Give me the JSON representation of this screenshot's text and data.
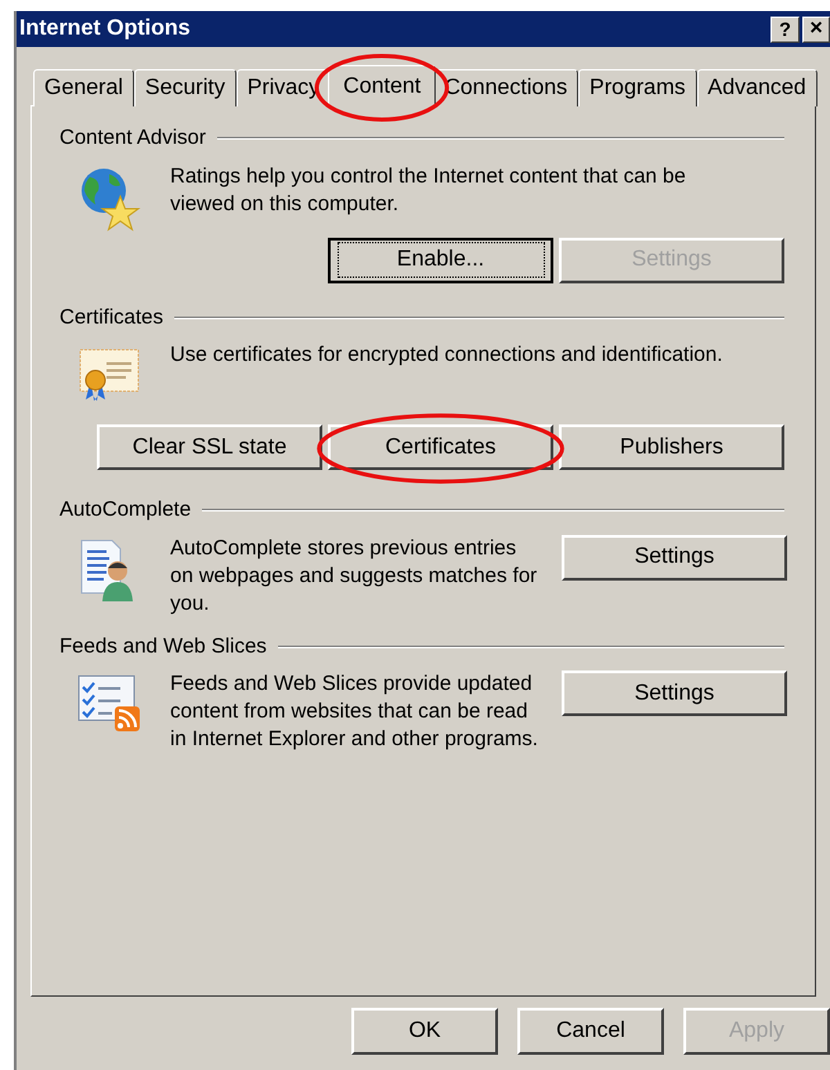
{
  "window": {
    "title": "Internet Options",
    "help_button": "?",
    "close_button": "×"
  },
  "tabs": [
    {
      "label": "General",
      "selected": false,
      "circled": false
    },
    {
      "label": "Security",
      "selected": false,
      "circled": false
    },
    {
      "label": "Privacy",
      "selected": false,
      "circled": false
    },
    {
      "label": "Content",
      "selected": true,
      "circled": true
    },
    {
      "label": "Connections",
      "selected": false,
      "circled": false
    },
    {
      "label": "Programs",
      "selected": false,
      "circled": false
    },
    {
      "label": "Advanced",
      "selected": false,
      "circled": false
    }
  ],
  "sections": [
    {
      "title": "Content Advisor",
      "kind": "stacked",
      "description": "Ratings help you control the Internet content that can be viewed on this computer.",
      "buttons": [
        {
          "label": "Enable...",
          "disabled": false,
          "default": true,
          "circled": false
        },
        {
          "label": "Settings",
          "disabled": true,
          "default": false,
          "circled": false
        }
      ]
    },
    {
      "title": "Certificates",
      "kind": "stacked",
      "description": "Use certificates for encrypted connections and identification.",
      "buttons": [
        {
          "label": "Clear SSL state",
          "disabled": false,
          "default": false,
          "circled": false
        },
        {
          "label": "Certificates",
          "disabled": false,
          "default": false,
          "circled": true
        },
        {
          "label": "Publishers",
          "disabled": false,
          "default": false,
          "circled": false
        }
      ]
    },
    {
      "title": "AutoComplete",
      "kind": "inline",
      "description": "AutoComplete stores previous entries on webpages and suggests matches for you.",
      "buttons": [
        {
          "label": "Settings",
          "disabled": false,
          "default": false,
          "circled": false
        }
      ]
    },
    {
      "title": "Feeds and Web Slices",
      "kind": "inline",
      "description": "Feeds and Web Slices provide updated content from websites that can be read in Internet Explorer and other programs.",
      "buttons": [
        {
          "label": "Settings",
          "disabled": false,
          "default": false,
          "circled": false
        }
      ]
    }
  ],
  "footer_buttons": [
    {
      "label": "OK",
      "disabled": false
    },
    {
      "label": "Cancel",
      "disabled": false
    },
    {
      "label": "Apply",
      "disabled": true
    }
  ]
}
